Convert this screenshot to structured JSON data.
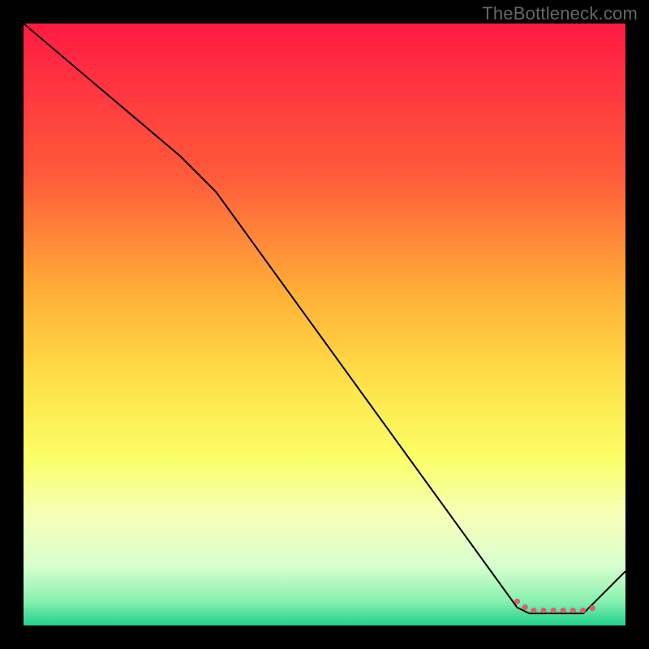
{
  "watermark": "TheBottleneck.com",
  "chart_data": {
    "type": "line",
    "title": "",
    "xlabel": "",
    "ylabel": "",
    "xlim": [
      0,
      100
    ],
    "ylim": [
      0,
      100
    ],
    "background_gradient": {
      "stops": [
        {
          "offset": 0,
          "color": "#ff1a44"
        },
        {
          "offset": 25,
          "color": "#ff5a3a"
        },
        {
          "offset": 45,
          "color": "#ffb038"
        },
        {
          "offset": 60,
          "color": "#ffe24a"
        },
        {
          "offset": 72,
          "color": "#fbff66"
        },
        {
          "offset": 82,
          "color": "#f5ffb8"
        },
        {
          "offset": 90,
          "color": "#d9ffcf"
        },
        {
          "offset": 96,
          "color": "#88f0b0"
        },
        {
          "offset": 100,
          "color": "#1fd18b"
        }
      ]
    },
    "series": [
      {
        "name": "main-curve",
        "stroke": "#000000",
        "stroke_width": 2,
        "points": [
          {
            "x": 0,
            "y": 100
          },
          {
            "x": 26,
            "y": 78
          },
          {
            "x": 32,
            "y": 72
          },
          {
            "x": 82,
            "y": 3
          },
          {
            "x": 84,
            "y": 2
          },
          {
            "x": 93,
            "y": 2
          },
          {
            "x": 100,
            "y": 9
          }
        ]
      },
      {
        "name": "threshold-band",
        "stroke": "#d9606a",
        "stroke_width": 7,
        "linecap": "round",
        "dash": "0.1 12",
        "points": [
          {
            "x": 82,
            "y": 4
          },
          {
            "x": 84,
            "y": 2.5
          },
          {
            "x": 93,
            "y": 2.5
          },
          {
            "x": 95,
            "y": 3
          }
        ]
      }
    ]
  }
}
